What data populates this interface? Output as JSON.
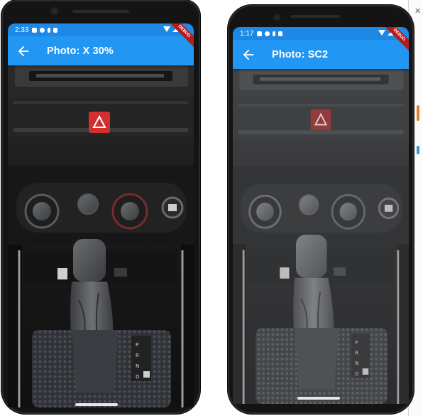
{
  "phones": [
    {
      "status_time": "2:33",
      "title": "Photo: X 30%",
      "debug_label": "DEBUG"
    },
    {
      "status_time": "1:17",
      "title": "Photo: SC2",
      "debug_label": "DEBUG"
    }
  ],
  "icons": {
    "back": "arrow-back-icon",
    "status": [
      "gear-icon",
      "shield-icon",
      "download-icon",
      "sim-card-icon",
      "wifi-icon",
      "signal-icon"
    ]
  },
  "colors": {
    "appbar": "#2196F3",
    "statusbar": "#1E88E5",
    "debug_banner": "#b71c1c",
    "hazard_button": "#d32f2f"
  }
}
